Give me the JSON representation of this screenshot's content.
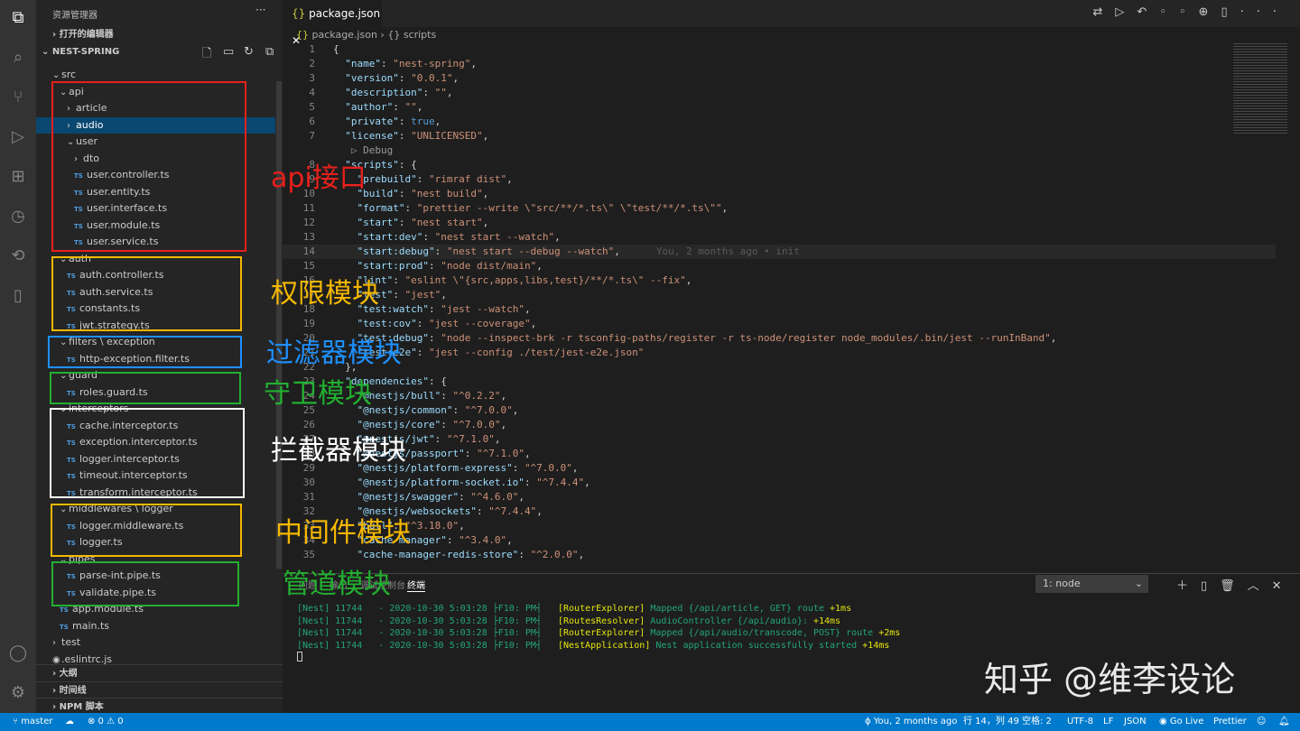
{
  "activity_bar": [
    "files",
    "search",
    "source-control",
    "run-debug",
    "extensions",
    "timeline",
    "remote",
    "book",
    "account",
    "settings"
  ],
  "sidebar": {
    "title": "资源管理器",
    "more": "···",
    "open_editors": "打开的编辑器",
    "project": "NEST-SPRING",
    "tree": [
      {
        "label": "src",
        "d": 0,
        "t": "open"
      },
      {
        "label": "api",
        "d": 1,
        "t": "open"
      },
      {
        "label": "article",
        "d": 2,
        "t": "closed"
      },
      {
        "label": "audio",
        "d": 2,
        "t": "closed",
        "sel": true
      },
      {
        "label": "user",
        "d": 2,
        "t": "open"
      },
      {
        "label": "dto",
        "d": 3,
        "t": "closed"
      },
      {
        "label": "user.controller.ts",
        "d": 3,
        "t": "ts"
      },
      {
        "label": "user.entity.ts",
        "d": 3,
        "t": "ts"
      },
      {
        "label": "user.interface.ts",
        "d": 3,
        "t": "ts"
      },
      {
        "label": "user.module.ts",
        "d": 3,
        "t": "ts"
      },
      {
        "label": "user.service.ts",
        "d": 3,
        "t": "ts"
      },
      {
        "label": "auth",
        "d": 1,
        "t": "open"
      },
      {
        "label": "auth.controller.ts",
        "d": 2,
        "t": "ts"
      },
      {
        "label": "auth.service.ts",
        "d": 2,
        "t": "ts"
      },
      {
        "label": "constants.ts",
        "d": 2,
        "t": "ts"
      },
      {
        "label": "jwt.strategy.ts",
        "d": 2,
        "t": "ts"
      },
      {
        "label": "filters \\ exception",
        "d": 1,
        "t": "open"
      },
      {
        "label": "http-exception.filter.ts",
        "d": 2,
        "t": "ts"
      },
      {
        "label": "guard",
        "d": 1,
        "t": "open"
      },
      {
        "label": "roles.guard.ts",
        "d": 2,
        "t": "ts"
      },
      {
        "label": "interceptors",
        "d": 1,
        "t": "open"
      },
      {
        "label": "cache.interceptor.ts",
        "d": 2,
        "t": "ts"
      },
      {
        "label": "exception.interceptor.ts",
        "d": 2,
        "t": "ts"
      },
      {
        "label": "logger.interceptor.ts",
        "d": 2,
        "t": "ts"
      },
      {
        "label": "timeout.interceptor.ts",
        "d": 2,
        "t": "ts"
      },
      {
        "label": "transform.interceptor.ts",
        "d": 2,
        "t": "ts"
      },
      {
        "label": "middlewares \\ logger",
        "d": 1,
        "t": "open"
      },
      {
        "label": "logger.middleware.ts",
        "d": 2,
        "t": "ts"
      },
      {
        "label": "logger.ts",
        "d": 2,
        "t": "ts"
      },
      {
        "label": "pipes",
        "d": 1,
        "t": "open"
      },
      {
        "label": "parse-int.pipe.ts",
        "d": 2,
        "t": "ts"
      },
      {
        "label": "validate.pipe.ts",
        "d": 2,
        "t": "ts"
      },
      {
        "label": "app.module.ts",
        "d": 1,
        "t": "ts"
      },
      {
        "label": "main.ts",
        "d": 1,
        "t": "ts"
      },
      {
        "label": "test",
        "d": 0,
        "t": "closed"
      },
      {
        "label": ".eslintrc.js",
        "d": 0,
        "t": "file"
      }
    ],
    "sections": [
      "大纲",
      "时间线",
      "NPM 脚本"
    ]
  },
  "editor": {
    "tab": "package.json",
    "tab_icon": "{}",
    "breadcrumb": [
      "package.json",
      "scripts"
    ],
    "codelens": "▷ Debug",
    "blame": "You, 2 months ago • init",
    "lines": [
      [
        "1",
        "",
        "",
        "{",
        0
      ],
      [
        "2",
        "\"name\"",
        "\"nest-spring\"",
        ",",
        1
      ],
      [
        "3",
        "\"version\"",
        "\"0.0.1\"",
        ",",
        1
      ],
      [
        "4",
        "\"description\"",
        "\"\"",
        ",",
        1
      ],
      [
        "5",
        "\"author\"",
        "\"\"",
        ",",
        1
      ],
      [
        "6",
        "\"private\"",
        "true",
        ",",
        1
      ],
      [
        "7",
        "\"license\"",
        "\"UNLICENSED\"",
        ",",
        1
      ],
      [
        "8",
        "\"scripts\"",
        "",
        "{",
        1
      ],
      [
        "9",
        "\"prebuild\"",
        "\"rimraf dist\"",
        ",",
        2
      ],
      [
        "10",
        "\"build\"",
        "\"nest build\"",
        ",",
        2
      ],
      [
        "11",
        "\"format\"",
        "\"prettier --write \\\"src/**/*.ts\\\" \\\"test/**/*.ts\\\"\"",
        ",",
        2
      ],
      [
        "12",
        "\"start\"",
        "\"nest start\"",
        ",",
        2
      ],
      [
        "13",
        "\"start:dev\"",
        "\"nest start --watch\"",
        ",",
        2
      ],
      [
        "14",
        "\"start:debug\"",
        "\"nest start --debug --watch\"",
        ",",
        2
      ],
      [
        "15",
        "\"start:prod\"",
        "\"node dist/main\"",
        ",",
        2
      ],
      [
        "16",
        "\"lint\"",
        "\"eslint \\\"{src,apps,libs,test}/**/*.ts\\\" --fix\"",
        ",",
        2
      ],
      [
        "17",
        "\"test\"",
        "\"jest\"",
        ",",
        2
      ],
      [
        "18",
        "\"test:watch\"",
        "\"jest --watch\"",
        ",",
        2
      ],
      [
        "19",
        "\"test:cov\"",
        "\"jest --coverage\"",
        ",",
        2
      ],
      [
        "20",
        "\"test:debug\"",
        "\"node --inspect-brk -r tsconfig-paths/register -r ts-node/register node_modules/.bin/jest --runInBand\"",
        ",",
        2
      ],
      [
        "21",
        "\"test:e2e\"",
        "\"jest --config ./test/jest-e2e.json\"",
        "",
        2
      ],
      [
        "22",
        "",
        "",
        "},",
        1
      ],
      [
        "23",
        "\"dependencies\"",
        "",
        "{",
        1
      ],
      [
        "24",
        "\"@nestjs/bull\"",
        "\"^0.2.2\"",
        ",",
        2
      ],
      [
        "25",
        "\"@nestjs/common\"",
        "\"^7.0.0\"",
        ",",
        2
      ],
      [
        "26",
        "\"@nestjs/core\"",
        "\"^7.0.0\"",
        ",",
        2
      ],
      [
        "27",
        "\"@nestjs/jwt\"",
        "\"^7.1.0\"",
        ",",
        2
      ],
      [
        "28",
        "\"@nestjs/passport\"",
        "\"^7.1.0\"",
        ",",
        2
      ],
      [
        "29",
        "\"@nestjs/platform-express\"",
        "\"^7.0.0\"",
        ",",
        2
      ],
      [
        "30",
        "\"@nestjs/platform-socket.io\"",
        "\"^7.4.4\"",
        ",",
        2
      ],
      [
        "31",
        "\"@nestjs/swagger\"",
        "\"^4.6.0\"",
        ",",
        2
      ],
      [
        "32",
        "\"@nestjs/websockets\"",
        "\"^7.4.4\"",
        ",",
        2
      ],
      [
        "33",
        "\"bull\"",
        "\"^3.18.0\"",
        ",",
        2
      ],
      [
        "34",
        "\"cache-manager\"",
        "\"^3.4.0\"",
        ",",
        2
      ],
      [
        "35",
        "\"cache-manager-redis-store\"",
        "\"^2.0.0\"",
        ",",
        2
      ]
    ]
  },
  "panel": {
    "tabs": [
      "问题",
      "输出",
      "调试控制台",
      "终端"
    ],
    "terminal_select": "1: node",
    "lines": [
      [
        "[Nest] 11744   - 2020-10-30 5:03:28 ├F10: PM┤   ",
        "[RouterExplorer]",
        " Mapped {/api/article, GET} route ",
        "+1ms"
      ],
      [
        "[Nest] 11744   - 2020-10-30 5:03:28 ├F10: PM┤   ",
        "[RoutesResolver]",
        " AudioController {/api/audio}: ",
        "+14ms"
      ],
      [
        "[Nest] 11744   - 2020-10-30 5:03:28 ├F10: PM┤   ",
        "[RouterExplorer]",
        " Mapped {/api/audio/transcode, POST} route ",
        "+2ms"
      ],
      [
        "[Nest] 11744   - 2020-10-30 5:03:28 ├F10: PM┤   ",
        "[NestApplication]",
        " Nest application successfully started ",
        "+14ms"
      ]
    ]
  },
  "status": {
    "branch": "master",
    "problems": "⊗ 0 ⚠ 0",
    "blame": "You, 2 months ago",
    "position": "行 14，列 49",
    "indent": "空格: 2",
    "encoding": "UTF-8",
    "eol": "LF",
    "language": "JSON",
    "golive": "Go Live",
    "prettier": "Prettier",
    "color": "#007acc"
  },
  "annotations": [
    {
      "label": "api接口",
      "color": "#e8201c"
    },
    {
      "label": "权限模块",
      "color": "#f5b800"
    },
    {
      "label": "过滤器模块",
      "color": "#1e90ff"
    },
    {
      "label": "守卫模块",
      "color": "#22b030"
    },
    {
      "label": "拦截器模块",
      "color": "#ffffff"
    },
    {
      "label": "中间件模块",
      "color": "#f5b800"
    },
    {
      "label": "管道模块",
      "color": "#22b030"
    }
  ],
  "watermark": "知乎 @维李设论"
}
